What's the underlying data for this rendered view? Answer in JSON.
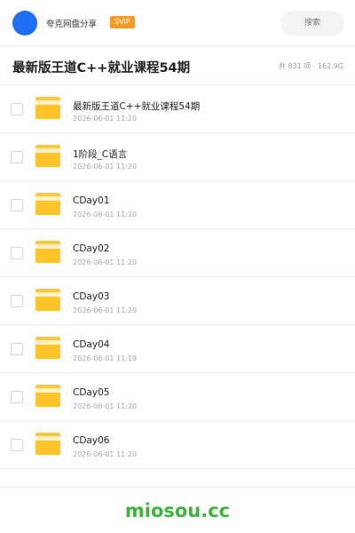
{
  "header": {
    "sharer_name": "夸克网盘分享",
    "badge": "SVIP",
    "search_placeholder": "搜索"
  },
  "share": {
    "title": "最新版王道C++就业课程54期",
    "meta": "共 831 项 · 162.9G"
  },
  "files": [
    {
      "name": "最新版王道C++就业课程54期",
      "date": "2026-06-01 11:20"
    },
    {
      "name": "1阶段_C语言",
      "date": "2026-06-01 11:20"
    },
    {
      "name": "CDay01",
      "date": "2026-06-01 11:20"
    },
    {
      "name": "CDay02",
      "date": "2026-06-01 11:20"
    },
    {
      "name": "CDay03",
      "date": "2026-06-01 11:20"
    },
    {
      "name": "CDay04",
      "date": "2026-06-01 11:19"
    },
    {
      "name": "CDay05",
      "date": "2026-06-01 11:20"
    },
    {
      "name": "CDay06",
      "date": "2026-06-01 11:20"
    }
  ],
  "footer": {
    "watermark": "miosou.cc"
  },
  "colors": {
    "avatar": "#1e6ff3",
    "badge": "#f59a23",
    "folder": "#ffc42a",
    "watermark": "#3cb43c"
  }
}
